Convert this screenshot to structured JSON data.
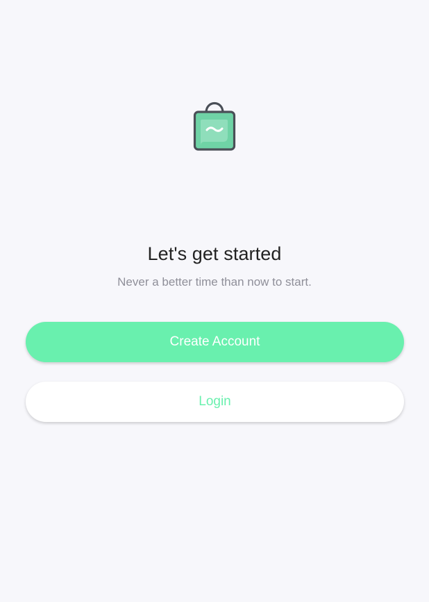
{
  "hero": {
    "logo_icon": "shopping-bag-icon",
    "title": "Let's get started",
    "subtitle": "Never a better time than now to start."
  },
  "actions": {
    "create_account_label": "Create Account",
    "login_label": "Login"
  },
  "colors": {
    "accent": "#69f0ae",
    "background": "#f7f7fb",
    "title": "#222222",
    "subtitle": "#8f8f99",
    "bag_fill": "#6fd3a6",
    "bag_outline": "#4a4f57"
  }
}
